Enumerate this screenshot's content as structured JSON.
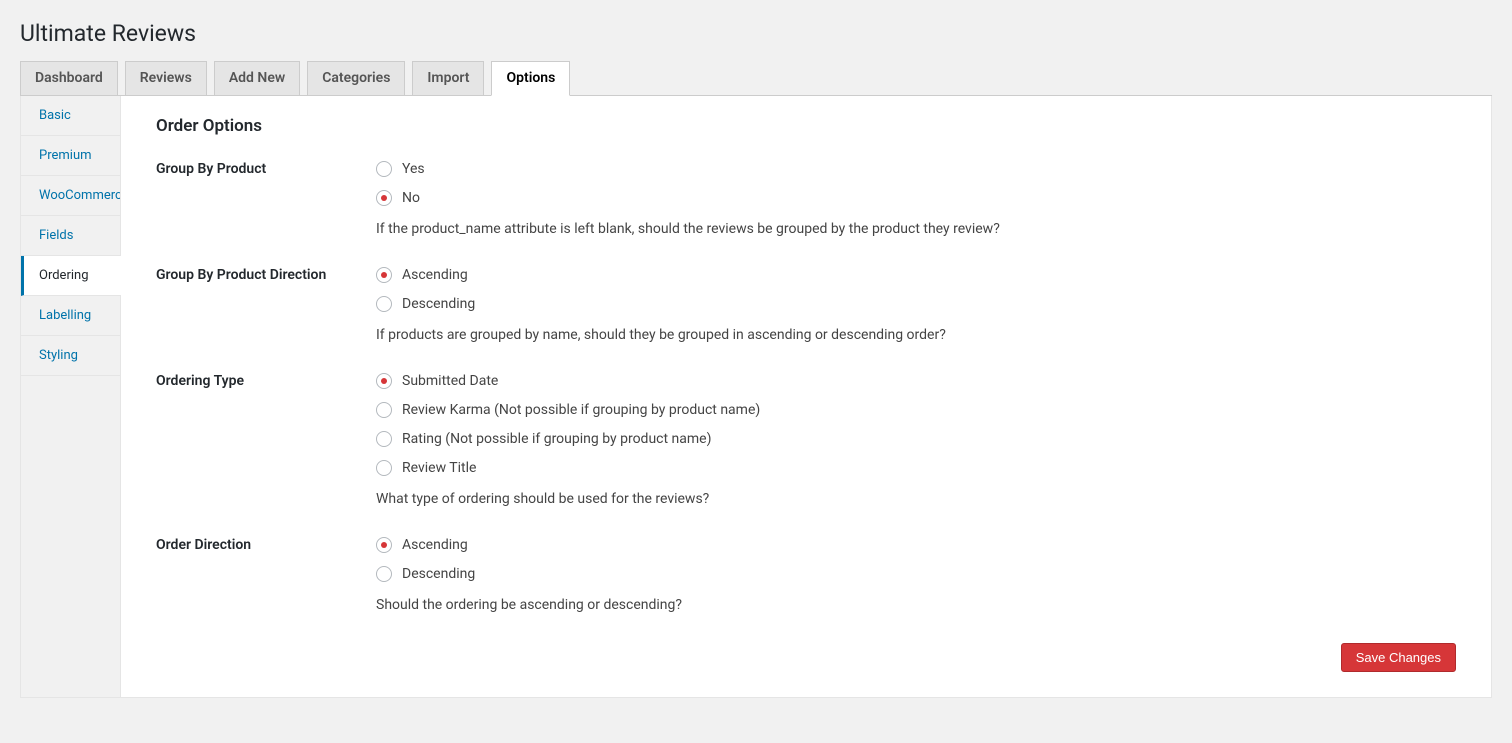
{
  "page_title": "Ultimate Reviews",
  "tabs": [
    {
      "label": "Dashboard",
      "active": false
    },
    {
      "label": "Reviews",
      "active": false
    },
    {
      "label": "Add New",
      "active": false
    },
    {
      "label": "Categories",
      "active": false
    },
    {
      "label": "Import",
      "active": false
    },
    {
      "label": "Options",
      "active": true
    }
  ],
  "sidebar": [
    {
      "label": "Basic",
      "active": false
    },
    {
      "label": "Premium",
      "active": false
    },
    {
      "label": "WooCommerce",
      "active": false
    },
    {
      "label": "Fields",
      "active": false
    },
    {
      "label": "Ordering",
      "active": true
    },
    {
      "label": "Labelling",
      "active": false
    },
    {
      "label": "Styling",
      "active": false
    }
  ],
  "section_title": "Order Options",
  "fields": {
    "group_by_product": {
      "label": "Group By Product",
      "options": [
        {
          "label": "Yes",
          "checked": false
        },
        {
          "label": "No",
          "checked": true
        }
      ],
      "description": "If the product_name attribute is left blank, should the reviews be grouped by the product they review?"
    },
    "group_by_product_direction": {
      "label": "Group By Product Direction",
      "options": [
        {
          "label": "Ascending",
          "checked": true
        },
        {
          "label": "Descending",
          "checked": false
        }
      ],
      "description": "If products are grouped by name, should they be grouped in ascending or descending order?"
    },
    "ordering_type": {
      "label": "Ordering Type",
      "options": [
        {
          "label": "Submitted Date",
          "checked": true
        },
        {
          "label": "Review Karma (Not possible if grouping by product name)",
          "checked": false
        },
        {
          "label": "Rating (Not possible if grouping by product name)",
          "checked": false
        },
        {
          "label": "Review Title",
          "checked": false
        }
      ],
      "description": "What type of ordering should be used for the reviews?"
    },
    "order_direction": {
      "label": "Order Direction",
      "options": [
        {
          "label": "Ascending",
          "checked": true
        },
        {
          "label": "Descending",
          "checked": false
        }
      ],
      "description": "Should the ordering be ascending or descending?"
    }
  },
  "save_button": "Save Changes"
}
